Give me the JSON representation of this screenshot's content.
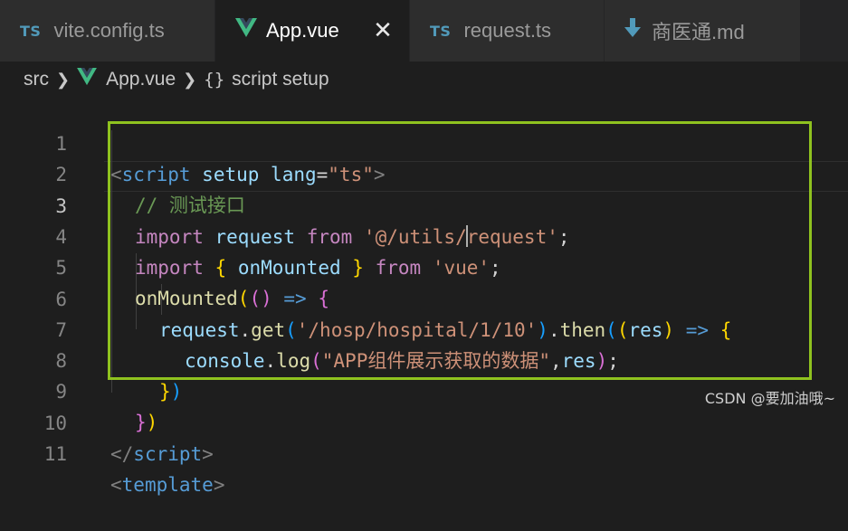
{
  "tabs": [
    {
      "badge": "TS",
      "label": "vite.config.ts",
      "active": false
    },
    {
      "badge": "",
      "label": "App.vue",
      "active": true,
      "close": "✕"
    },
    {
      "badge": "TS",
      "label": "request.ts",
      "active": false
    },
    {
      "badge": "",
      "label": "商医通.md",
      "active": false
    }
  ],
  "breadcrumb": {
    "folder": "src",
    "file": "App.vue",
    "symbol_icon": "{}",
    "symbol": "script setup"
  },
  "editor": {
    "line_numbers": [
      "1",
      "2",
      "3",
      "4",
      "5",
      "6",
      "7",
      "8",
      "9",
      "10",
      "11"
    ],
    "active_line": "3",
    "lines": {
      "l1": {
        "open": "<",
        "tag": "script",
        "attr1": "setup",
        "attr2": "lang",
        "eq": "=",
        "val": "\"ts\"",
        "close": ">"
      },
      "l2": {
        "comment": "// 测试接口"
      },
      "l3": {
        "kw": "import",
        "id": "request",
        "from": "from",
        "str_a": "'@/utils/",
        "str_b": "request'",
        "semi": ";"
      },
      "l4": {
        "kw": "import",
        "lb": "{",
        "id": "onMounted",
        "rb": "}",
        "from": "from",
        "str": "'vue'",
        "semi": ";"
      },
      "l5": {
        "fn": "onMounted",
        "p1": "(",
        "p2": "()",
        "arrow": "=>",
        "brace": "{"
      },
      "l6": {
        "obj": "request",
        "dot": ".",
        "fn": "get",
        "p1": "(",
        "str": "'/hosp/hospital/1/10'",
        "p1c": ")",
        "dot2": ".",
        "fn2": "then",
        "p2": "(",
        "p3": "(",
        "param": "res",
        "p3c": ")",
        "arrow": "=>",
        "brace": "{"
      },
      "l7": {
        "obj": "console",
        "dot": ".",
        "fn": "log",
        "p1": "(",
        "str": "\"APP组件展示获取的数据\"",
        "comma": ",",
        "id": "res",
        "p1c": ")",
        "semi": ";"
      },
      "l8": {
        "brace": "}",
        "paren": ")"
      },
      "l9": {
        "brace": "}",
        "paren": ")"
      },
      "l10": {
        "open": "</",
        "tag": "script",
        "close": ">"
      },
      "l11": {
        "open": "<",
        "tag": "template",
        "close": ">"
      }
    }
  },
  "watermark": "CSDN @要加油哦~",
  "colors": {
    "highlight_box": "#8fc21f",
    "ts_badge": "#519aba",
    "vue_green": "#41b883"
  }
}
